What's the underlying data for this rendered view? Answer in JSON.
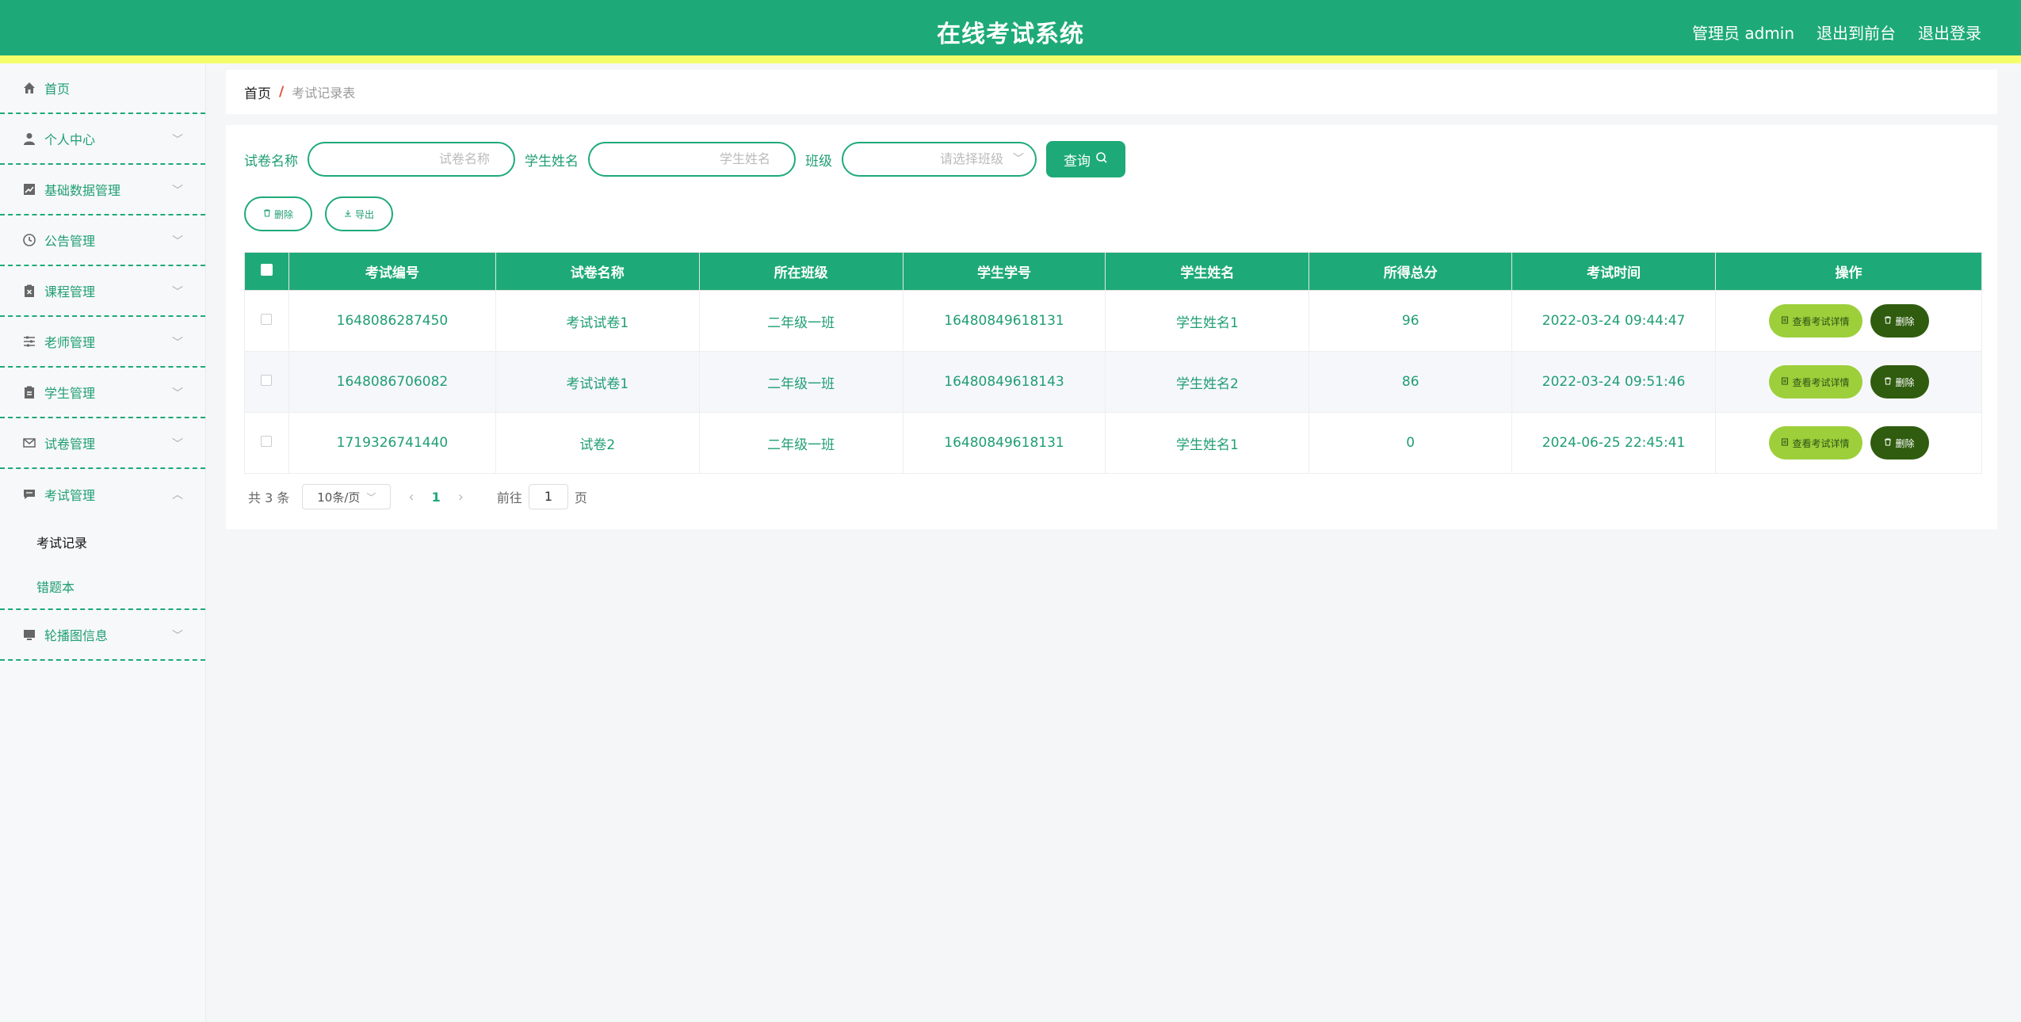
{
  "header": {
    "title": "在线考试系统",
    "user": "管理员 admin",
    "to_front": "退出到前台",
    "logout": "退出登录"
  },
  "sidebar": {
    "items": [
      {
        "label": "首页",
        "icon": "home-icon",
        "has_chevron": false
      },
      {
        "label": "个人中心",
        "icon": "user-icon",
        "has_chevron": true
      },
      {
        "label": "基础数据管理",
        "icon": "chart-icon",
        "has_chevron": true
      },
      {
        "label": "公告管理",
        "icon": "clock-icon",
        "has_chevron": true
      },
      {
        "label": "课程管理",
        "icon": "clipboard-x-icon",
        "has_chevron": true
      },
      {
        "label": "老师管理",
        "icon": "sliders-icon",
        "has_chevron": true
      },
      {
        "label": "学生管理",
        "icon": "clipboard-icon",
        "has_chevron": true
      },
      {
        "label": "试卷管理",
        "icon": "mail-icon",
        "has_chevron": true
      },
      {
        "label": "考试管理",
        "icon": "chat-icon",
        "has_chevron": true,
        "expanded": true
      },
      {
        "label": "轮播图信息",
        "icon": "monitor-icon",
        "has_chevron": true
      }
    ],
    "submenu": [
      {
        "label": "考试记录",
        "active": true
      },
      {
        "label": "错题本",
        "active": false
      }
    ]
  },
  "breadcrumb": {
    "home": "首页",
    "separator": "/",
    "current": "考试记录表"
  },
  "search": {
    "paper_label": "试卷名称",
    "paper_placeholder": "试卷名称",
    "student_label": "学生姓名",
    "student_placeholder": "学生姓名",
    "class_label": "班级",
    "class_placeholder": "请选择班级",
    "query_button": "查询"
  },
  "actions": {
    "delete": "删除",
    "export": "导出"
  },
  "table": {
    "headers": [
      "考试编号",
      "试卷名称",
      "所在班级",
      "学生学号",
      "学生姓名",
      "所得总分",
      "考试时间",
      "操作"
    ],
    "rows": [
      {
        "id": "1648086287450",
        "paper": "考试试卷1",
        "class": "二年级一班",
        "student_no": "16480849618131",
        "student_name": "学生姓名1",
        "score": "96",
        "time": "2022-03-24 09:44:47"
      },
      {
        "id": "1648086706082",
        "paper": "考试试卷1",
        "class": "二年级一班",
        "student_no": "16480849618143",
        "student_name": "学生姓名2",
        "score": "86",
        "time": "2022-03-24 09:51:46"
      },
      {
        "id": "1719326741440",
        "paper": "试卷2",
        "class": "二年级一班",
        "student_no": "16480849618131",
        "student_name": "学生姓名1",
        "score": "0",
        "time": "2024-06-25 22:45:41"
      }
    ],
    "detail_button": "查看考试详情",
    "delete_button": "删除"
  },
  "pagination": {
    "total": "共 3 条",
    "page_size": "10条/页",
    "current_page": "1",
    "goto_prefix": "前往",
    "goto_value": "1",
    "goto_suffix": "页"
  },
  "colors": {
    "primary": "#1eaa78",
    "accent_strip": "#f3ff6a",
    "detail_btn": "#9ccf3a",
    "delete_btn": "#2f5c0e"
  }
}
